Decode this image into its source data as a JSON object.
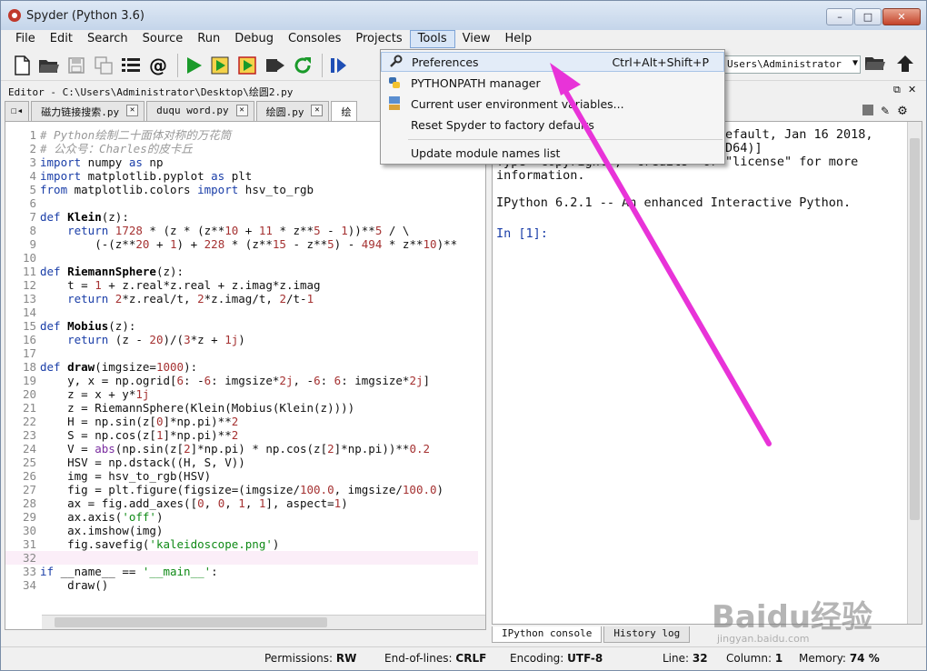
{
  "window": {
    "title": "Spyder (Python 3.6)"
  },
  "menubar": [
    "File",
    "Edit",
    "Search",
    "Source",
    "Run",
    "Debug",
    "Consoles",
    "Projects",
    "Tools",
    "View",
    "Help"
  ],
  "toolbar": {
    "path": "Users\\Administrator"
  },
  "editor": {
    "header": "Editor - C:\\Users\\Administrator\\Desktop\\绘圆2.py",
    "tabs": [
      {
        "label": "磁力链接搜索.py"
      },
      {
        "label": "duqu word.py"
      },
      {
        "label": "绘圆.py"
      },
      {
        "label": "绘"
      }
    ]
  },
  "code": [
    {
      "n": "1",
      "html": "<span class=\"cm\"># Python绘制二十面体对称的万花筒</span>"
    },
    {
      "n": "2",
      "html": "<span class=\"cm\"># 公众号：Charles的皮卡丘</span>"
    },
    {
      "n": "3",
      "html": "<span class=\"kw\">import</span> numpy <span class=\"kw\">as</span> np"
    },
    {
      "n": "4",
      "html": "<span class=\"kw\">import</span> matplotlib.pyplot <span class=\"kw\">as</span> plt"
    },
    {
      "n": "5",
      "html": "<span class=\"kw\">from</span> matplotlib.colors <span class=\"kw\">import</span> hsv_to_rgb"
    },
    {
      "n": "6",
      "html": ""
    },
    {
      "n": "7",
      "html": "<span class=\"kw\">def</span> <span class=\"fn\">Klein</span>(z):"
    },
    {
      "n": "8",
      "html": "    <span class=\"kw\">return</span> <span class=\"num\">1728</span> * (z * (z**<span class=\"num\">10</span> + <span class=\"num\">11</span> * z**<span class=\"num\">5</span> - <span class=\"num\">1</span>))**<span class=\"num\">5</span> / \\"
    },
    {
      "n": "9",
      "html": "        (-(z**<span class=\"num\">20</span> + <span class=\"num\">1</span>) + <span class=\"num\">228</span> * (z**<span class=\"num\">15</span> - z**<span class=\"num\">5</span>) - <span class=\"num\">494</span> * z**<span class=\"num\">10</span>)**"
    },
    {
      "n": "10",
      "html": ""
    },
    {
      "n": "11",
      "html": "<span class=\"kw\">def</span> <span class=\"fn\">RiemannSphere</span>(z):"
    },
    {
      "n": "12",
      "html": "    t = <span class=\"num\">1</span> + z.real*z.real + z.imag*z.imag"
    },
    {
      "n": "13",
      "html": "    <span class=\"kw\">return</span> <span class=\"num\">2</span>*z.real/t, <span class=\"num\">2</span>*z.imag/t, <span class=\"num\">2</span>/t-<span class=\"num\">1</span>"
    },
    {
      "n": "14",
      "html": ""
    },
    {
      "n": "15",
      "html": "<span class=\"kw\">def</span> <span class=\"fn\">Mobius</span>(z):"
    },
    {
      "n": "16",
      "html": "    <span class=\"kw\">return</span> (z - <span class=\"num\">20</span>)/(<span class=\"num\">3</span>*z + <span class=\"num\">1j</span>)"
    },
    {
      "n": "17",
      "html": ""
    },
    {
      "n": "18",
      "html": "<span class=\"kw\">def</span> <span class=\"fn\">draw</span>(imgsize=<span class=\"num\">1000</span>):"
    },
    {
      "n": "19",
      "html": "    y, x = np.ogrid[<span class=\"num\">6</span>: -<span class=\"num\">6</span>: imgsize*<span class=\"num\">2j</span>, -<span class=\"num\">6</span>: <span class=\"num\">6</span>: imgsize*<span class=\"num\">2j</span>]"
    },
    {
      "n": "20",
      "html": "    z = x + y*<span class=\"num\">1j</span>"
    },
    {
      "n": "21",
      "html": "    z = RiemannSphere(Klein(Mobius(Klein(z))))"
    },
    {
      "n": "22",
      "html": "    H = np.sin(z[<span class=\"num\">0</span>]*np.pi)**<span class=\"num\">2</span>"
    },
    {
      "n": "23",
      "html": "    S = np.cos(z[<span class=\"num\">1</span>]*np.pi)**<span class=\"num\">2</span>"
    },
    {
      "n": "24",
      "html": "    V = <span class=\"bi\">abs</span>(np.sin(z[<span class=\"num\">2</span>]*np.pi) * np.cos(z[<span class=\"num\">2</span>]*np.pi))**<span class=\"num\">0.2</span>"
    },
    {
      "n": "25",
      "html": "    HSV = np.dstack((H, S, V))"
    },
    {
      "n": "26",
      "html": "    img = hsv_to_rgb(HSV)"
    },
    {
      "n": "27",
      "html": "    fig = plt.figure(figsize=(imgsize/<span class=\"num\">100.0</span>, imgsize/<span class=\"num\">100.0</span>)"
    },
    {
      "n": "28",
      "html": "    ax = fig.add_axes([<span class=\"num\">0</span>, <span class=\"num\">0</span>, <span class=\"num\">1</span>, <span class=\"num\">1</span>], aspect=<span class=\"num\">1</span>)"
    },
    {
      "n": "29",
      "html": "    ax.axis(<span class=\"str\">'off'</span>)"
    },
    {
      "n": "30",
      "html": "    ax.imshow(img)"
    },
    {
      "n": "31",
      "html": "    fig.savefig(<span class=\"str\">'kaleidoscope.png'</span>)"
    },
    {
      "n": "32",
      "html": "",
      "current": true
    },
    {
      "n": "33",
      "html": "<span class=\"kw\">if</span> __name__ == <span class=\"str\">'__main__'</span>:"
    },
    {
      "n": "34",
      "html": "    draw()"
    }
  ],
  "console": {
    "lines": [
      {
        "text": "                              default, Jan 16 2018,"
      },
      {
        "text": "                              MD64)]"
      },
      {
        "text": "Type \"copyright\", \"credits\" or \"license\" for more"
      },
      {
        "text": "information."
      },
      {
        "text": ""
      },
      {
        "text": "IPython 6.2.1 -- An enhanced Interactive Python."
      },
      {
        "text": ""
      }
    ],
    "prompt": "In [1]:",
    "tabs": [
      "IPython console",
      "History log"
    ]
  },
  "tools_menu": {
    "items": [
      {
        "label": "Preferences",
        "shortcut": "Ctrl+Alt+Shift+P",
        "icon": "wrench-icon"
      },
      {
        "label": "PYTHONPATH manager",
        "icon": "python-icon"
      },
      {
        "label": "Current user environment variables...",
        "icon": "environment-icon"
      },
      {
        "label": "Reset Spyder to factory defaults",
        "icon": ""
      },
      {
        "label": "Update module names list",
        "icon": ""
      }
    ]
  },
  "statusbar": {
    "permissions_label": "Permissions:",
    "permissions": "RW",
    "eol_label": "End-of-lines:",
    "eol": "CRLF",
    "encoding_label": "Encoding:",
    "encoding": "UTF-8",
    "line_label": "Line:",
    "line": "32",
    "column_label": "Column:",
    "column": "1",
    "memory_label": "Memory:",
    "memory": "74 %"
  },
  "watermark": {
    "brand": "Baidu经验",
    "url": "jingyan.baidu.com"
  },
  "colors": {
    "arrow": "#e833d8",
    "keyword": "#1a3ea8",
    "string": "#0f8a16",
    "number": "#a53232"
  }
}
